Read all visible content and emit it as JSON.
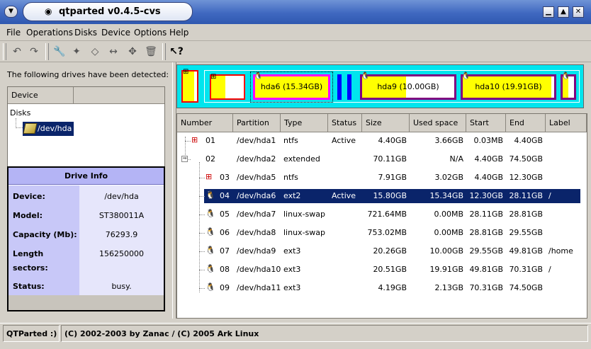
{
  "window": {
    "title": "qtparted v0.4.5-cvs"
  },
  "menubar": {
    "items": [
      "File",
      "Operations",
      "Disks",
      "Device",
      "Options",
      "Help"
    ]
  },
  "toolbar": {
    "buttons": [
      "undo-icon",
      "redo-icon",
      "properties-icon",
      "format-icon",
      "eraser-icon",
      "resize-icon",
      "move-icon",
      "delete-icon",
      "whats-this-icon"
    ]
  },
  "left": {
    "detected_label": "The following drives have been detected:",
    "tree": {
      "column_header": "Device",
      "root": "Disks",
      "device": "/dev/hda"
    },
    "drive_info": {
      "title": "Drive Info",
      "rows": [
        {
          "label": "Device:",
          "value": "/dev/hda"
        },
        {
          "label": "Model:",
          "value": "ST380011A"
        },
        {
          "label": "Capacity (Mb):",
          "value": "76293.9"
        },
        {
          "label": "Length sectors:",
          "value": "156250000"
        },
        {
          "label": "Status:",
          "value": "busy."
        }
      ]
    }
  },
  "map": {
    "colors": {
      "border": "#ff0000",
      "linux": "#ff00ff",
      "fill": "#ffff00",
      "swap": "#0000ff",
      "ext3": "#800080"
    },
    "segments": [
      {
        "name": "hda1",
        "label": ""
      },
      {
        "name": "hda5",
        "label": ""
      },
      {
        "name": "hda6",
        "label": "hda6 (15.34GB)"
      },
      {
        "name": "hda9",
        "label": "hda9 (10.00GB)"
      },
      {
        "name": "hda10",
        "label": "hda10 (19.91GB)"
      }
    ]
  },
  "table": {
    "columns": [
      "Number",
      "Partition",
      "Type",
      "Status",
      "Size",
      "Used space",
      "Start",
      "End",
      "Label"
    ],
    "rows": [
      {
        "number": "01",
        "partition": "/dev/hda1",
        "type": "ntfs",
        "status": "Active",
        "size": "4.40GB",
        "used": "3.66GB",
        "start": "0.03MB",
        "end": "4.40GB",
        "label": "",
        "icon": "windows-icon",
        "level": 0
      },
      {
        "number": "02",
        "partition": "/dev/hda2",
        "type": "extended",
        "status": "",
        "size": "70.11GB",
        "used": "N/A",
        "start": "4.40GB",
        "end": "74.50GB",
        "label": "",
        "icon": "",
        "level": 0
      },
      {
        "number": "03",
        "partition": "/dev/hda5",
        "type": "ntfs",
        "status": "",
        "size": "7.91GB",
        "used": "3.02GB",
        "start": "4.40GB",
        "end": "12.30GB",
        "label": "",
        "icon": "windows-icon",
        "level": 1
      },
      {
        "number": "04",
        "partition": "/dev/hda6",
        "type": "ext2",
        "status": "Active",
        "size": "15.80GB",
        "used": "15.34GB",
        "start": "12.30GB",
        "end": "28.11GB",
        "label": "/",
        "icon": "tux-icon",
        "level": 1,
        "selected": true
      },
      {
        "number": "05",
        "partition": "/dev/hda7",
        "type": "linux-swap",
        "status": "",
        "size": "721.64MB",
        "used": "0.00MB",
        "start": "28.11GB",
        "end": "28.81GB",
        "label": "",
        "icon": "tux-icon",
        "level": 1
      },
      {
        "number": "06",
        "partition": "/dev/hda8",
        "type": "linux-swap",
        "status": "",
        "size": "753.02MB",
        "used": "0.00MB",
        "start": "28.81GB",
        "end": "29.55GB",
        "label": "",
        "icon": "tux-icon",
        "level": 1
      },
      {
        "number": "07",
        "partition": "/dev/hda9",
        "type": "ext3",
        "status": "",
        "size": "20.26GB",
        "used": "10.00GB",
        "start": "29.55GB",
        "end": "49.81GB",
        "label": "/home",
        "icon": "tux-icon",
        "level": 1
      },
      {
        "number": "08",
        "partition": "/dev/hda10",
        "type": "ext3",
        "status": "",
        "size": "20.51GB",
        "used": "19.91GB",
        "start": "49.81GB",
        "end": "70.31GB",
        "label": "/",
        "icon": "tux-icon",
        "level": 1
      },
      {
        "number": "09",
        "partition": "/dev/hda11",
        "type": "ext3",
        "status": "",
        "size": "4.19GB",
        "used": "2.13GB",
        "start": "70.31GB",
        "end": "74.50GB",
        "label": "",
        "icon": "tux-icon",
        "level": 1
      }
    ]
  },
  "statusbar": {
    "app": "QTParted :)",
    "copyright": "(C) 2002-2003 by Zanac / (C) 2005 Ark Linux"
  }
}
